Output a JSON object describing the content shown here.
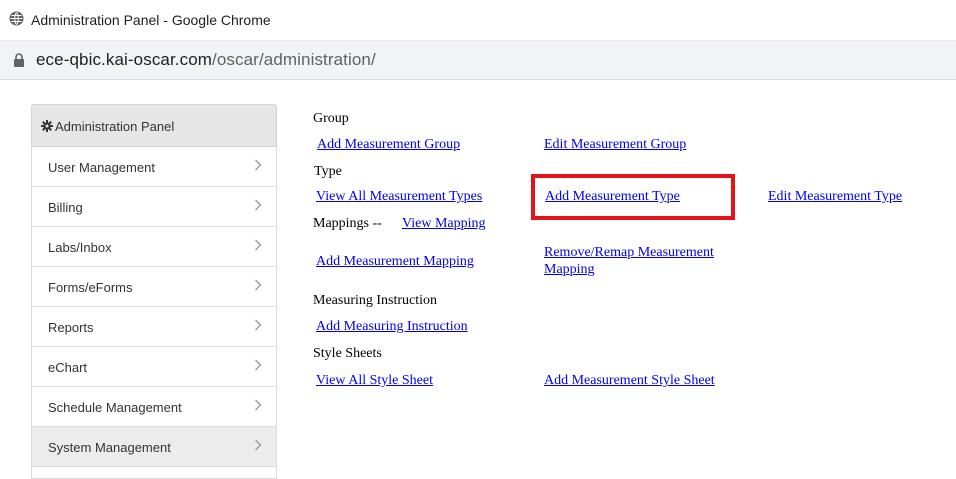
{
  "browser": {
    "window_title": "Administration Panel - Google Chrome",
    "url_host": "ece-qbic.kai-oscar.com",
    "url_path": "/oscar/administration/"
  },
  "sidebar": {
    "header_label": "Administration Panel",
    "items": [
      {
        "label": "User Management"
      },
      {
        "label": "Billing"
      },
      {
        "label": "Labs/Inbox"
      },
      {
        "label": "Forms/eForms"
      },
      {
        "label": "Reports"
      },
      {
        "label": "eChart"
      },
      {
        "label": "Schedule Management"
      },
      {
        "label": "System Management"
      }
    ]
  },
  "main": {
    "group_heading": "Group",
    "add_group": "Add Measurement Group",
    "edit_group": "Edit Measurement Group",
    "type_heading": "Type",
    "view_all_types": "View All Measurement Types",
    "add_type": "Add Measurement Type",
    "edit_type": "Edit Measurement Type",
    "mappings_heading": "Mappings --",
    "view_mapping": "View Mapping",
    "add_mapping": "Add Measurement Mapping",
    "remove_remap_line1": "Remove/Remap Measurement",
    "remove_remap_line2": "Mapping",
    "instruction_heading": "Measuring Instruction",
    "add_instruction": "Add Measuring Instruction",
    "stylesheets_heading": "Style Sheets",
    "view_all_stylesheets": "View All Style Sheet",
    "add_stylesheet": "Add Measurement Style Sheet"
  },
  "colors": {
    "link": "#0000ee",
    "highlight": "#e5121a"
  }
}
